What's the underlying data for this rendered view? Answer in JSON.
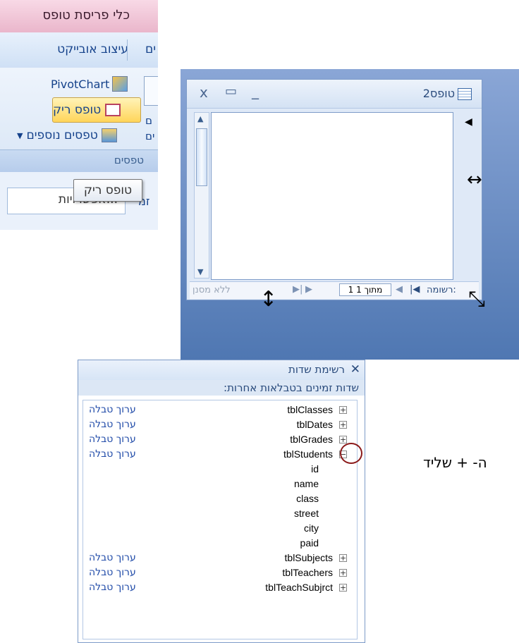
{
  "ribbon": {
    "contextual_tab": "כלי פריסת טופס",
    "tab_format": "עיצוב אובייקט",
    "tab_partial": "ים",
    "pivotchart_label": "PivotChart",
    "blank_form_label": "טופס ריק",
    "more_forms_label": "טפסים נוספים",
    "side_label_1": "ם",
    "side_label_2": "ים",
    "group_name": "טפסים",
    "options_label": "...אפשרויות",
    "lower_partial": "זמ",
    "tooltip": "טופס ריק"
  },
  "form_window": {
    "title": "טופס2",
    "close_glyph": "x",
    "restore_glyph": "▭",
    "minimize_glyph": "_",
    "nav": {
      "record_label": "רשומה:",
      "record_position": "1 מתוך 1",
      "filter_label": "ללא מסנן",
      "first": "|◀",
      "prev": "◀",
      "next": "▶",
      "last": "▶|"
    }
  },
  "field_list": {
    "title": "רשימת שדות",
    "section_header": "שדות זמינים בטבלאות אחרות:",
    "edit_label": "ערוך טבלה",
    "tables": [
      {
        "name": "tblClasses",
        "expanded": false
      },
      {
        "name": "tblDates",
        "expanded": false
      },
      {
        "name": "tblGrades",
        "expanded": false
      },
      {
        "name": "tblStudents",
        "expanded": true,
        "fields": [
          "id",
          "name",
          "class",
          "street",
          "city",
          "paid"
        ]
      },
      {
        "name": "tblSubjects",
        "expanded": false
      },
      {
        "name": "tblTeachers",
        "expanded": false
      },
      {
        "name": "tblTeachSubjrct",
        "expanded": false
      }
    ]
  },
  "caption": "ה- + שליד",
  "colors": {
    "ribbon_contextual": "#eab6cb",
    "ribbon_blue": "#dbe8f8",
    "blank_button_highlight": "#ffd55a",
    "panel_blue": "#4f77b2",
    "link_blue": "#1f4aa8",
    "highlight_circle": "#8b1a1a"
  }
}
